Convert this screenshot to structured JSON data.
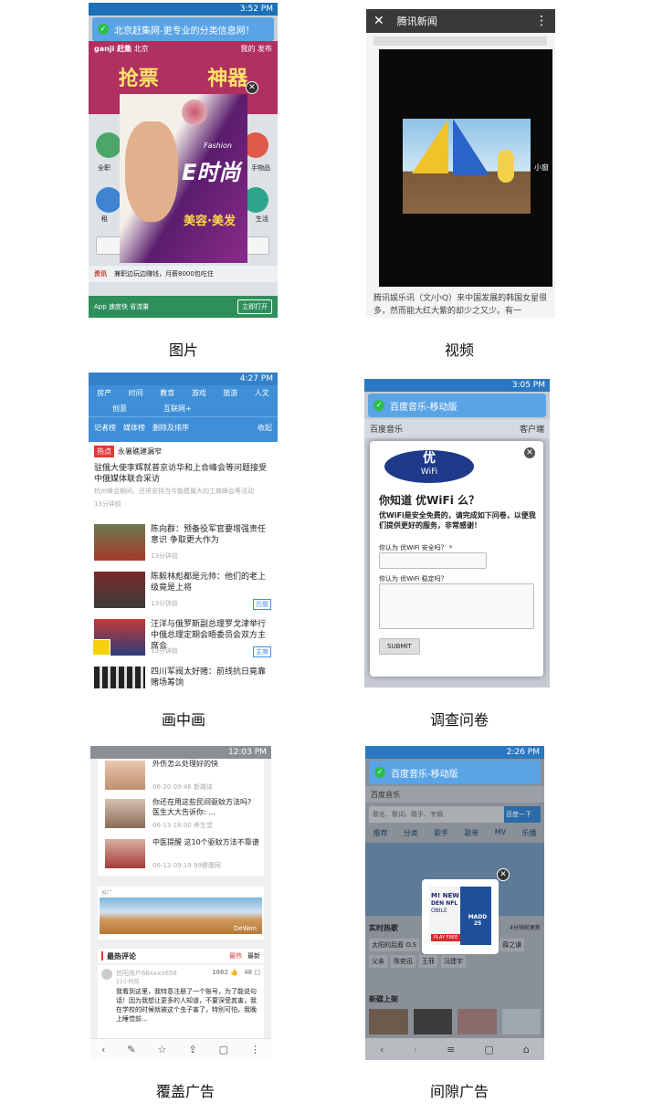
{
  "captions": {
    "image": "图片",
    "video": "视频",
    "pip": "画中画",
    "survey": "调查问卷",
    "overlay": "覆盖广告",
    "interstitial": "间隙广告"
  },
  "colors": {
    "blue": "#3e8fd8",
    "statusGreen": "#2dbd4a",
    "ganjiRed": "#b03060",
    "adPurple": "#6a1f7a",
    "wifiNavy": "#1f3a8a",
    "tencentBar": "#3a3a3a"
  },
  "phone1": {
    "time": "3:52 PM",
    "notice": "北京赶集网-更专业的分类信息网！",
    "city": "北京",
    "nav": [
      "我的",
      "发布"
    ],
    "banner_left": "抢票",
    "banner_right": "神器",
    "ad_brand": "E时尚",
    "ad_fashion": "Fashion",
    "ad_slogan": "美容·美发",
    "side_left": [
      "全职",
      "租"
    ],
    "side_right": [
      "手物品",
      "生活"
    ],
    "info_label": "资讯",
    "info_text": "兼职边玩边赚钱，月薪8000包吃住",
    "bottom_app": "App 速度快 省流量",
    "bottom_btn": "立即打开",
    "logo": "ganji 赶集"
  },
  "phone2": {
    "title": "腾讯新闻",
    "video_label": "小窗",
    "body_text": "腾讯娱乐讯（文/小Q）来中国发展的韩国女星很多，然而能大红大紫的却少之又少。有一"
  },
  "phone3": {
    "time": "4:27 PM",
    "tabs_row1": [
      "房产",
      "时间",
      "教育",
      "游戏",
      "旅游",
      "人文"
    ],
    "tabs_row2": [
      "创意",
      "互联网+"
    ],
    "tools": [
      "记者榜",
      "媒体榜",
      "删除及排序"
    ],
    "collapse": "收起",
    "hot_badge": "热点",
    "hot_title": "永暑礁建漏窄",
    "headline": "驻俄大使李辉就普京访华和上合峰会等问题接受中俄媒体联合采访",
    "headline_summary": "杭州峰会期间，还将安排当今能模最大的工商峰会等活动",
    "headline_time": "13分钟前",
    "news": [
      {
        "title": "陈向群：预备役军官要增强责任意识 争取更大作为",
        "time": "13分钟前",
        "tag": ""
      },
      {
        "title": "陈毅林彪都是元帅：他们的老上级竟是上将",
        "time": "13分钟前",
        "tag": "历叙"
      },
      {
        "title": "汪洋与俄罗斯副总理罗戈津举行中俄总理定期会晤委员会双方主席会",
        "time": "13分钟前",
        "tag": "主席"
      },
      {
        "title": "四川军阀太好赌：前线抗日竟靠赌场筹饷",
        "time": "",
        "tag": ""
      }
    ]
  },
  "phone4": {
    "time": "3:05 PM",
    "notice": "百度音乐-移动版",
    "site": "百度音乐",
    "client": "客户端",
    "logo_cn": "优",
    "logo_en": "WiFi",
    "heading": "你知道 优WiFi 么？",
    "intro": "优WiFi是安全免费的，请完成如下问卷，以便我们提供更好的服务，非常感谢！",
    "q1": "你认为 优WiFi 安全吗？ *",
    "q2": "你认为 优WiFi 稳定吗？",
    "submit": "SUBMIT"
  },
  "phone5": {
    "time": "12:03 PM",
    "articles": [
      {
        "title": "外伤怎么处理好的快",
        "date": "06-20 09:46",
        "source": "新媒体"
      },
      {
        "title": "你还在用这些民间驱蚊方法吗? 医生大大告诉你: ...",
        "date": "06-13 18:00",
        "source": "养生堂"
      },
      {
        "title": "中医提醒 这10个驱蚊方法不靠谱",
        "date": "06-13 09:19",
        "source": "99健康网"
      }
    ],
    "promo_label": "推广",
    "promo_brand": "DeWen",
    "comments_title": "最热评论",
    "comment_tabs": [
      "最热",
      "最新"
    ],
    "user": "信阳用户66xxxx658",
    "user_time": "11小时前",
    "likes": "1862",
    "replies": "48",
    "comment": "我看到这里，我特意注册了一个账号，为了能说句话！因为我想让更多的人知道，不要深受其害，我在学校的时候就被这个虫子害了，特别可怕，我晚上睡觉前..."
  },
  "phone6": {
    "time": "2:26 PM",
    "notice": "百度音乐-移动版",
    "site": "百度音乐",
    "search_placeholder": "歌名、歌词、歌手、专辑",
    "search_btn": "百度一下",
    "tabs": [
      "推荐",
      "分类",
      "歌手",
      "歌单",
      "MV",
      "乐播"
    ],
    "hot_title": "实时热歌",
    "hot_more": "4分钟前更新",
    "hot_songs": [
      "太阳的后裔 O.S",
      "儿歌",
      "薛之谦",
      "父亲",
      "陈奕迅",
      "王菲",
      "冯建宇"
    ],
    "new_title": "新碟上架",
    "ad_lines": [
      "M! NEW",
      "DEN NFL",
      "OBILE"
    ],
    "ad_madden": "MADD 25",
    "ad_cta": "PLAY FREE"
  }
}
